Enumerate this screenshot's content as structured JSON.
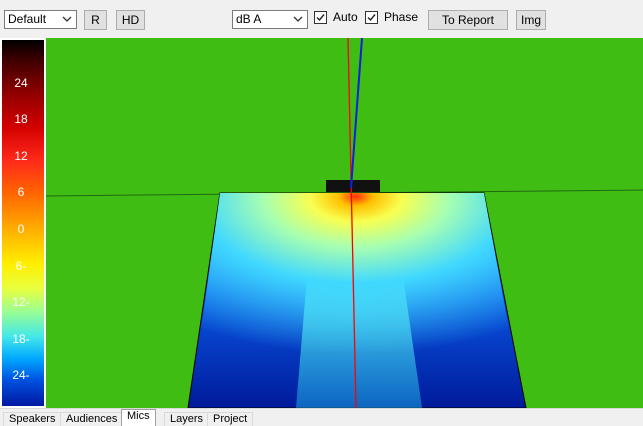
{
  "toolbar": {
    "preset_value": "Default",
    "r_label": "R",
    "hd_label": "HD",
    "unit_value": "dB A",
    "auto_label": "Auto",
    "auto_checked": true,
    "phase_label": "Phase",
    "phase_checked": true,
    "to_report_label": "To Report",
    "img_label": "Img"
  },
  "scale": {
    "labels": [
      "24",
      "18",
      "12",
      "6",
      "0",
      "6-",
      "12-",
      "18-",
      "24-"
    ]
  },
  "tabs": [
    {
      "label": "Speakers",
      "active": false
    },
    {
      "label": "Audiences",
      "active": false
    },
    {
      "label": "Mics",
      "active": true
    },
    {
      "label": "Layers",
      "active": false
    },
    {
      "label": "Project",
      "active": false
    }
  ],
  "colors": {
    "background_green": "#3fbd12",
    "heat_red": "#ff2a1a",
    "heat_yellow": "#ffee00",
    "heat_blue": "#0018a0"
  }
}
